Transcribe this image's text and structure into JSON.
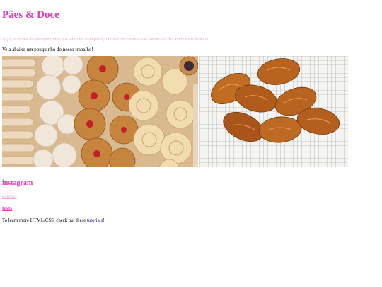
{
  "header": {
    "title": "Pães & Doce",
    "tagline": "Aqui, o aroma do pão quentinho e o sabor de cada pedaço feito com carinho vão tornar seu dia ainda mais especial."
  },
  "intro": {
    "text": "Veja abaixo um pouquinho do nosso trabalho!"
  },
  "gallery": {
    "images": [
      {
        "subject": "assorted sweet breads and pastries with jam"
      },
      {
        "subject": "croissants on cooling rack"
      }
    ]
  },
  "links": {
    "instagram": "instagram",
    "contact": "contato",
    "texts": "texts"
  },
  "footer": {
    "learn_prefix": "To learn more HTML/CSS, check out these ",
    "tutorials_label": "tutorials",
    "learn_suffix": "!"
  },
  "colors": {
    "brand_pink": "#e03fb5",
    "light_pink": "#f3a6de",
    "link_blue": "#1a0dab"
  }
}
